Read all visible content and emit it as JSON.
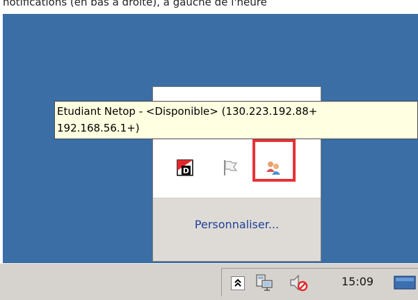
{
  "top_caption": "notifications (en bas à droite), à gauche de l'heure",
  "tooltip": {
    "line1": "Etudiant Netop - <Disponible> (130.223.192.88+",
    "line2": "192.168.56.1+)"
  },
  "overflow_panel": {
    "icons": [
      "netop-d-icon",
      "flag-icon",
      "netop-student-icon"
    ],
    "customize_label": "Personnaliser..."
  },
  "taskbar": {
    "clock": "15:09",
    "tray_icons": [
      "chevron-up-icon",
      "network-icon",
      "speaker-muted-icon",
      "show-desktop-icon"
    ]
  },
  "colors": {
    "desktop": "#3a6ea5",
    "tooltip_bg": "#ffffe1",
    "highlight": "#e63236",
    "link": "#1f3f99"
  }
}
